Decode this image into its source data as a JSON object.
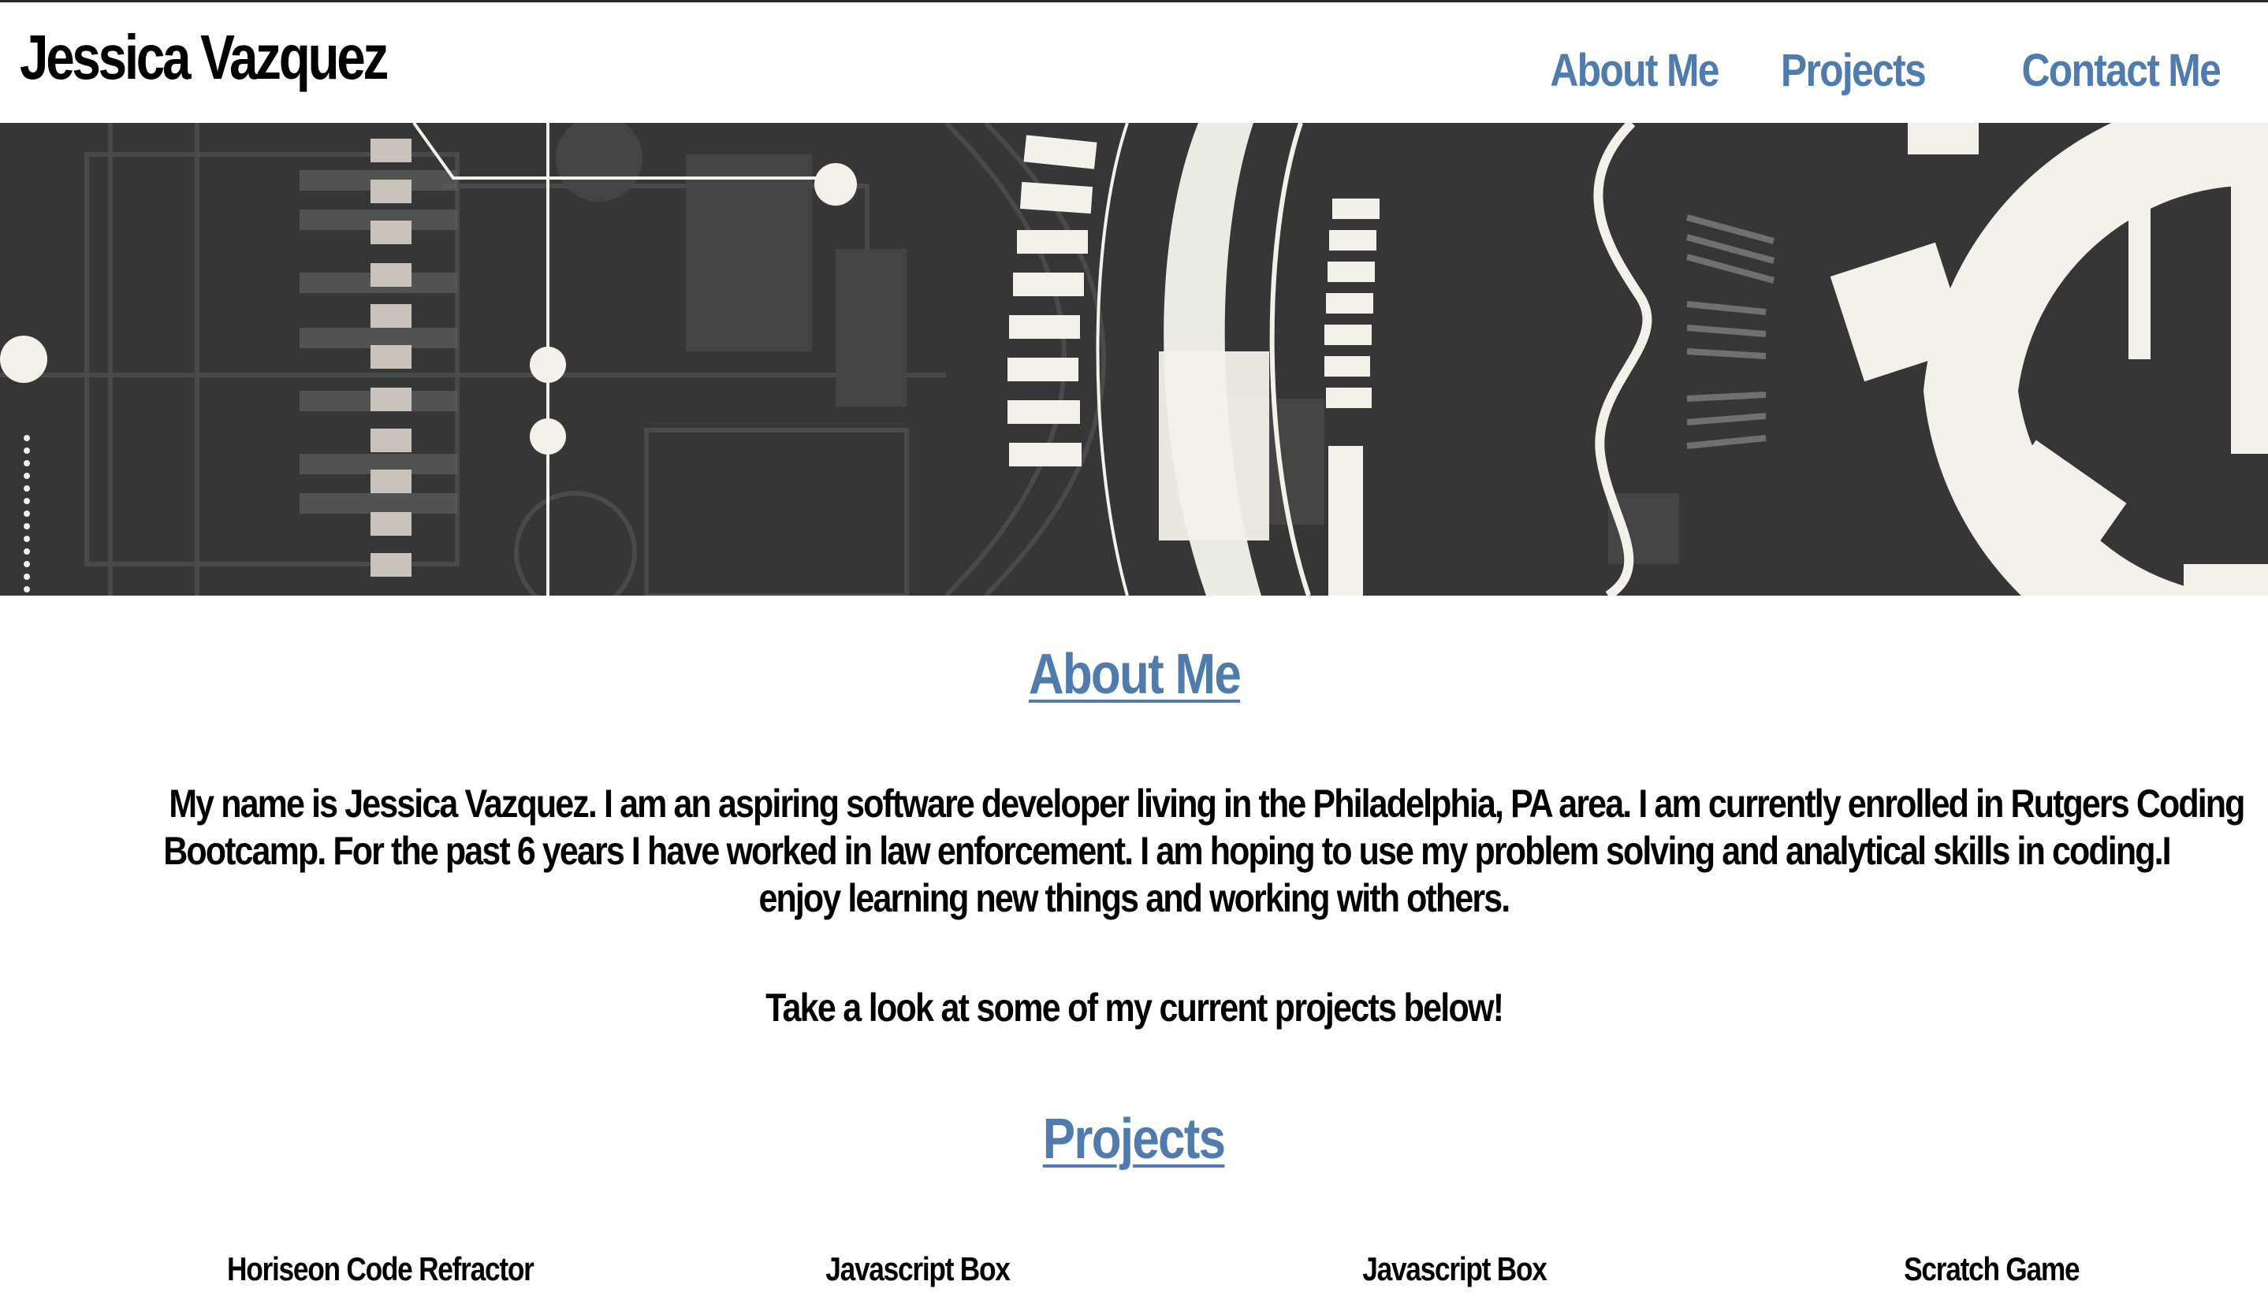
{
  "header": {
    "site_name": "Jessica Vazquez",
    "nav": [
      {
        "label": "About Me"
      },
      {
        "label": "Projects"
      },
      {
        "label": "Contact Me"
      }
    ]
  },
  "hero": {
    "image": "circuit-gear-banner",
    "colors": {
      "background": "#363636",
      "light": "#f3f1ea"
    }
  },
  "about": {
    "heading": "About Me",
    "paragraph_lines": [
      "My name is Jessica Vazquez. I am an aspiring software developer living in the Philadelphia, PA area. I am currently enrolled in Rutgers Coding",
      "Bootcamp. For the past 6 years I have worked in law enforcement. I am hoping to use my problem solving and analytical skills in coding.I",
      "enjoy learning new things and working with others."
    ],
    "cta": "Take a look at some of my current projects below!"
  },
  "projects": {
    "heading": "Projects",
    "items": [
      {
        "title": "Horiseon Code Refractor"
      },
      {
        "title": "Javascript Box"
      },
      {
        "title": "Javascript Box"
      },
      {
        "title": "Scratch Game"
      }
    ]
  },
  "colors": {
    "link": "#4f7bad",
    "text": "#000000",
    "background": "#ffffff"
  }
}
